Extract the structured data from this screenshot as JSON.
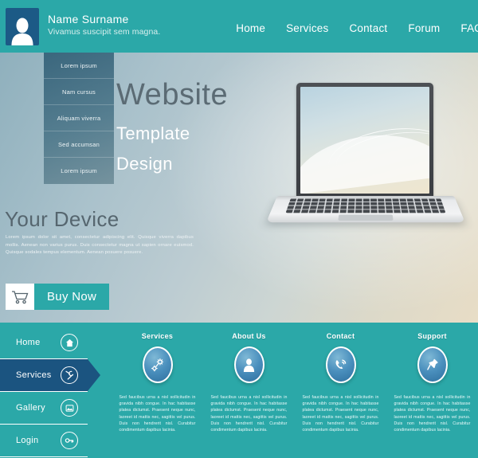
{
  "header": {
    "name": "Name Surname",
    "tagline": "Vivamus suscipit sem magna.",
    "avatar_icon": "person-icon",
    "nav": [
      {
        "label": "Home",
        "name": "nav-home"
      },
      {
        "label": "Services",
        "name": "nav-services"
      },
      {
        "label": "Contact",
        "name": "nav-contact"
      },
      {
        "label": "Forum",
        "name": "nav-forum"
      },
      {
        "label": "FAQ",
        "name": "nav-faq"
      }
    ]
  },
  "dropdown": {
    "items": [
      {
        "label": "Lorem ipsum"
      },
      {
        "label": "Nam cursus"
      },
      {
        "label": "Aliquam viverra"
      },
      {
        "label": "Sed accumsan"
      },
      {
        "label": "Lorem ipsum"
      }
    ]
  },
  "hero": {
    "title": "Website",
    "subtitle1": "Template",
    "subtitle2": "Design",
    "device_title": "Your Device",
    "device_body": "Lorem ipsum dolor sit amet, consectetur adipiscing elit. Quisque viverra dapibus mollis. Aenean non varius purus. Duis consectetur magna ut sapien ornare euismod. Quisque sodales tempus elementum. Aenean posuere posuere.",
    "buy_label": "Buy Now",
    "cart_icon": "shopping-cart-icon"
  },
  "sidebar": {
    "items": [
      {
        "label": "Home",
        "icon": "home-icon",
        "active": false
      },
      {
        "label": "Services",
        "icon": "wrench-icon",
        "active": true
      },
      {
        "label": "Gallery",
        "icon": "image-icon",
        "active": false
      },
      {
        "label": "Login",
        "icon": "key-icon",
        "active": false
      }
    ]
  },
  "features": [
    {
      "title": "Services",
      "icon": "gears-icon",
      "body": "Sed faucibus urna a nisl sollicitudin in gravida nibh congue. In hac habitasse platea dictumst. Praesent neque nunc, laoreet id mattis nec, sagittis vel purus. Duis non hendrerit nisl. Curabitur condimentum dapibus lacinia."
    },
    {
      "title": "About Us",
      "icon": "person-icon",
      "body": "Sed faucibus urna a nisl sollicitudin in gravida nibh congue. In hac habitasse platea dictumst. Praesent neque nunc, laoreet id mattis nec, sagittis vel purus. Duis non hendrerit nisl. Curabitur condimentum dapibus lacinia."
    },
    {
      "title": "Contact",
      "icon": "phone-icon",
      "body": "Sed faucibus urna a nisl sollicitudin in gravida nibh congue. In hac habitasse platea dictumst. Praesent neque nunc, laoreet id mattis nec, sagittis vel purus. Duis non hendrerit nisl. Curabitur condimentum dapibus lacinia."
    },
    {
      "title": "Support",
      "icon": "pin-icon",
      "body": "Sed faucibus urna a nisl sollicitudin in gravida nibh congue. In hac habitasse platea dictumst. Praesent neque nunc, laoreet id mattis nec, sagittis vel purus. Duis non hendrerit nisl. Curabitur condimentum dapibus lacinia."
    }
  ],
  "colors": {
    "teal": "#2ba8a8",
    "dark_blue": "#1b5480",
    "avatar_blue": "#1c5a86",
    "white": "#ffffff"
  }
}
